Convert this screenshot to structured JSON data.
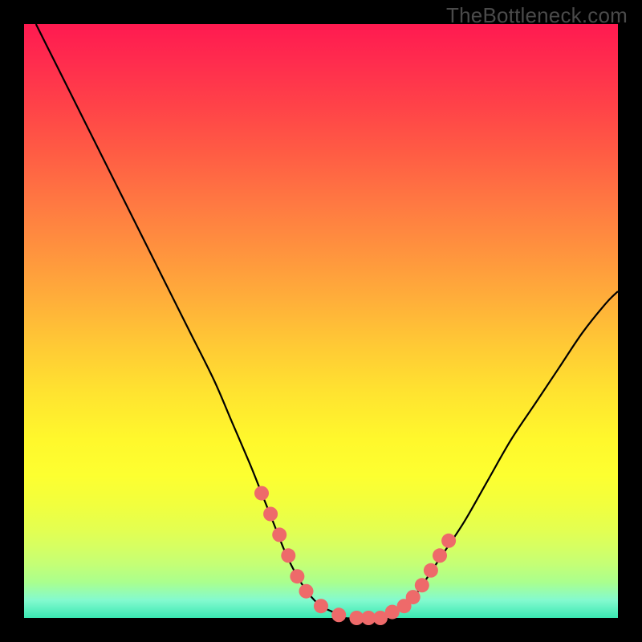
{
  "watermark": "TheBottleneck.com",
  "colors": {
    "page_bg": "#000000",
    "curve": "#000000",
    "marker_fill": "#ee6a6a",
    "marker_stroke": "#e65a5a"
  },
  "chart_data": {
    "type": "line",
    "title": "",
    "xlabel": "",
    "ylabel": "",
    "xlim": [
      0,
      100
    ],
    "ylim": [
      0,
      100
    ],
    "grid": false,
    "legend": false,
    "series": [
      {
        "name": "bottleneck-curve",
        "x": [
          2,
          5,
          8,
          12,
          16,
          20,
          24,
          28,
          32,
          35,
          38,
          40,
          42,
          44,
          46,
          48,
          50,
          52,
          54,
          56,
          58,
          60,
          62,
          64,
          66,
          70,
          74,
          78,
          82,
          86,
          90,
          94,
          98,
          100
        ],
        "y": [
          100,
          94,
          88,
          80,
          72,
          64,
          56,
          48,
          40,
          33,
          26,
          21,
          16,
          11,
          7,
          4,
          2,
          1,
          0,
          0,
          0,
          0,
          1,
          2,
          4,
          10,
          16,
          23,
          30,
          36,
          42,
          48,
          53,
          55
        ]
      }
    ],
    "markers": {
      "name": "highlight-points",
      "x": [
        40,
        41.5,
        43,
        44.5,
        46,
        47.5,
        50,
        53,
        56,
        58,
        60,
        62,
        64,
        65.5,
        67,
        68.5,
        70,
        71.5
      ],
      "y": [
        21,
        17.5,
        14,
        10.5,
        7,
        4.5,
        2,
        0.5,
        0,
        0,
        0,
        1,
        2,
        3.5,
        5.5,
        8,
        10.5,
        13
      ]
    }
  }
}
